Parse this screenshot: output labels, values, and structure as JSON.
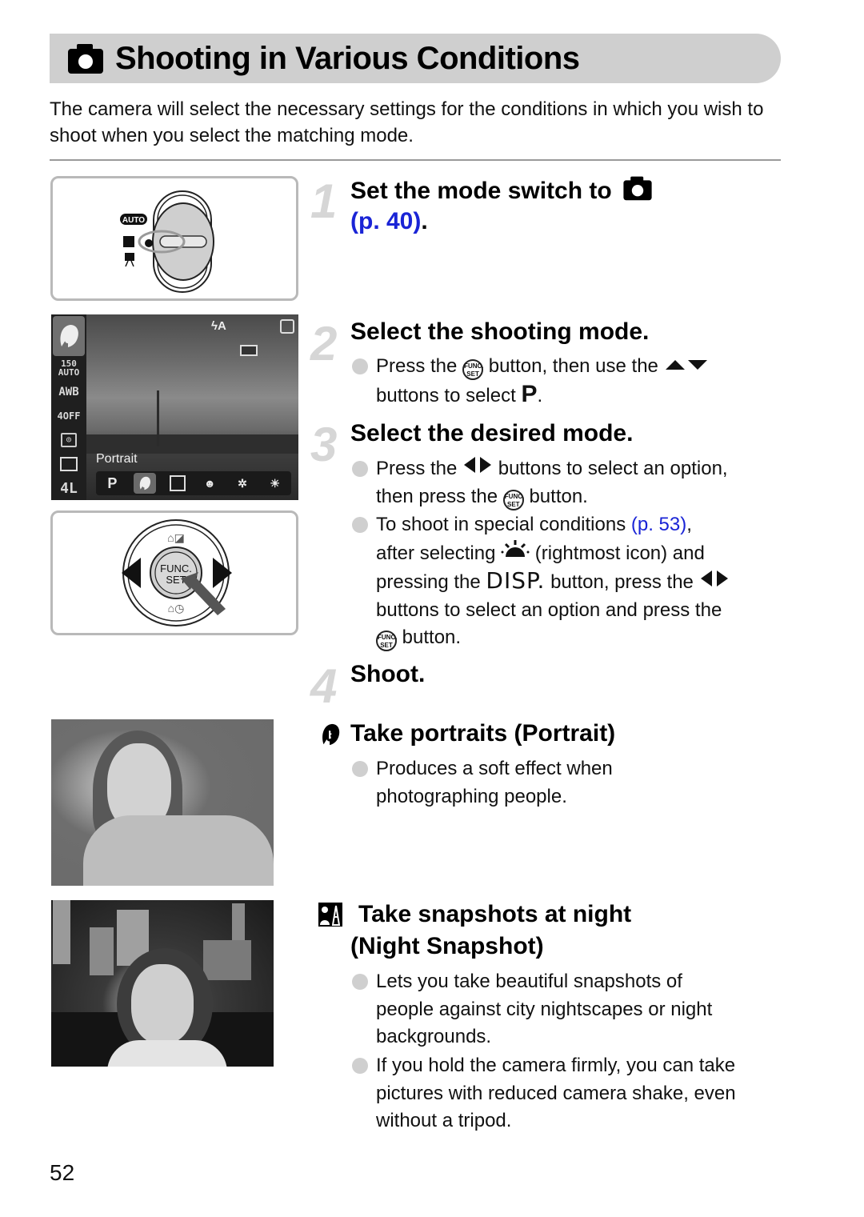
{
  "header": {
    "icon": "camera-icon",
    "title": "Shooting in Various Conditions"
  },
  "intro": "The camera will select the necessary settings for the conditions in which you wish to shoot when you select the matching mode.",
  "illustrations": {
    "mode_switch": {
      "label_auto": "AUTO",
      "icons": [
        "auto-mode-icon",
        "camera-mode-icon",
        "movie-mode-icon"
      ]
    },
    "lcd": {
      "sidebar": [
        "ISO 150 AUTO",
        "AWB",
        "4OFF",
        "metering",
        "□",
        "4L"
      ],
      "sidebar_icons": [
        "portrait-mode-icon",
        "iso-icon",
        "white-balance-icon",
        "flash-off-icon",
        "metering-icon",
        "drive-icon",
        "image-size-icon"
      ],
      "sidebar_iso": "150",
      "sidebar_iso_sub": "AUTO",
      "sidebar_awb": "AWB",
      "sidebar_flash": "4OFF",
      "sidebar_size": "4L",
      "flash_indicator": "ϟA",
      "mode_label": "Portrait",
      "menu": [
        "P",
        "portrait",
        "night-snapshot",
        "kids-pets",
        "indoor",
        "special-scene"
      ],
      "menu_p": "P",
      "selected_index": 1
    },
    "dial": {
      "center_label_1": "FUNC.",
      "center_label_2": "SET"
    }
  },
  "steps": [
    {
      "number": "1",
      "title": "Set the mode switch to",
      "title_icon": "camera-icon",
      "link": "(p. 40)",
      "link_suffix": "."
    },
    {
      "number": "2",
      "title": "Select the shooting mode.",
      "bullets": [
        {
          "pre": "Press the",
          "icon": "func-set-button-icon",
          "mid": "button, then use the",
          "icon2": "up-down-arrows-icon",
          "line2": "buttons to select",
          "bold": "P",
          "end": "."
        }
      ]
    },
    {
      "number": "3",
      "title": "Select the desired mode.",
      "bullets": [
        {
          "pre": "Press the",
          "icon": "left-right-arrows-icon",
          "mid": "buttons to select an option,",
          "line2_pre": "then press the",
          "icon2": "func-set-button-icon",
          "line2_post": "button."
        },
        {
          "pre": "To shoot in special conditions",
          "link": "(p. 53)",
          "link_post": ",",
          "line2_pre": "after selecting",
          "icon2": "special-scene-icon",
          "line2_post": "(rightmost icon) and",
          "line3_pre": "pressing the",
          "disp": "DISP.",
          "line3_mid": "button, press the",
          "icon3": "left-right-arrows-icon",
          "line4": "buttons to select an option and press the",
          "line5_icon": "func-set-button-icon",
          "line5_post": "button."
        }
      ]
    },
    {
      "number": "4",
      "title": "Shoot."
    }
  ],
  "modes": [
    {
      "icon": "portrait-mode-icon",
      "title": "Take portraits (Portrait)",
      "bullets": [
        "Produces a soft effect when",
        "photographing people."
      ]
    },
    {
      "icon": "night-snapshot-icon",
      "title_line1": "Take snapshots at night",
      "title_line2": "(Night Snapshot)",
      "bullets": [
        [
          "Lets you take beautiful snapshots of",
          "people against city nightscapes or night",
          "backgrounds."
        ],
        [
          "If you hold the camera firmly, you can take",
          "pictures with reduced camera shake, even",
          "without a tripod."
        ]
      ]
    }
  ],
  "func_icon_text": {
    "top": "FUNC.",
    "bottom": "SET"
  },
  "page_number": "52",
  "colors": {
    "link": "#1a24d6",
    "title_bar": "#cfcfcf",
    "step_number": "#d6d6d6",
    "bullet": "#cfcfcf"
  }
}
